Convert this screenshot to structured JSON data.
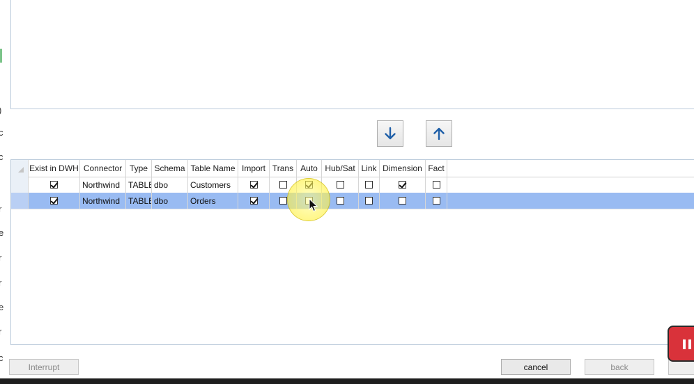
{
  "left_strip_glyphs": [
    ")",
    "c",
    "c",
    "r",
    "e",
    "r",
    "r",
    "e",
    "r",
    "c"
  ],
  "move_buttons": {
    "down_icon": "arrow-down-icon",
    "up_icon": "arrow-up-icon",
    "icon_color": "#1f5fa8"
  },
  "grid": {
    "columns": [
      "Exist in DWH",
      "Connector",
      "Type",
      "Schema",
      "Table Name",
      "Import",
      "Trans",
      "Auto",
      "Hub/Sat",
      "Link",
      "Dimension",
      "Fact"
    ],
    "rows": [
      {
        "exist_in_dwh": true,
        "connector": "Northwind",
        "type": "TABLE",
        "schema": "dbo",
        "table_name": "Customers",
        "import": true,
        "trans": false,
        "auto": true,
        "hub_sat": false,
        "link": false,
        "dimension": true,
        "fact": false,
        "selected": false
      },
      {
        "exist_in_dwh": true,
        "connector": "Northwind",
        "type": "TABLE",
        "schema": "dbo",
        "table_name": "Orders",
        "import": true,
        "trans": false,
        "auto": false,
        "hub_sat": false,
        "link": false,
        "dimension": false,
        "fact": false,
        "selected": true
      }
    ],
    "selected_row_color": "#99bbf2"
  },
  "buttons": {
    "interrupt": "Interrupt",
    "cancel": "cancel",
    "back": "back"
  },
  "recording_badge_icon": "pause-icon"
}
